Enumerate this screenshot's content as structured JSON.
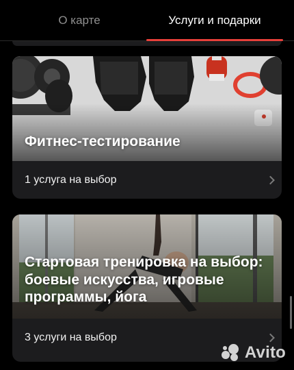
{
  "tabs": [
    {
      "label": "О карте",
      "active": false
    },
    {
      "label": "Услуги и подарки",
      "active": true
    }
  ],
  "accent_color": "#e8403a",
  "cards": [
    {
      "title": "Фитнес-тестирование",
      "footer": "1 услуга на выбор",
      "image": "fitness-gear-photo"
    },
    {
      "title": "Стартовая тренировка на выбор: боевые искусства, игровые программы, йога",
      "footer": "3 услуги на выбор",
      "image": "yoga-pose-photo"
    }
  ],
  "watermark": {
    "text": "Avito",
    "icon": "avito-dots-logo"
  }
}
